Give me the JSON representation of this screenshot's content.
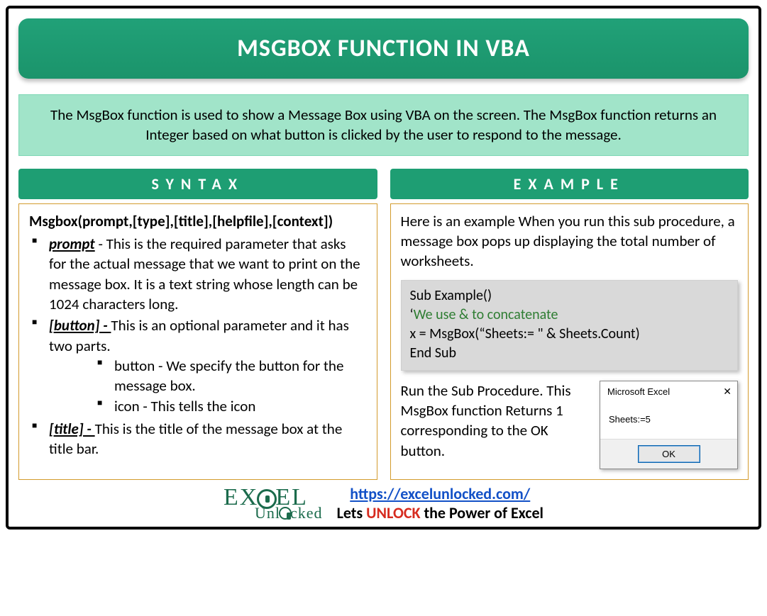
{
  "title": "MSGBOX FUNCTION IN VBA",
  "intro": "The MsgBox function is used to show a Message Box using VBA on the screen. The MsgBox function returns an Integer based on what button is clicked by the user to respond to the message.",
  "syntax": {
    "heading": "SYNTAX",
    "signature": "Msgbox(prompt,[type],[title],[helpfile],[context])",
    "params": {
      "prompt": {
        "name": "prompt",
        "desc": " - This is the required parameter that asks for the actual message that we want to print on the message box. It is a text string whose length can be 1024 characters long."
      },
      "button": {
        "name": "[button] - ",
        "desc": "This is an optional parameter and it has two parts.",
        "sub1": "button - We specify the button for the message box.",
        "sub2": "icon - This tells the icon"
      },
      "title": {
        "name": "[title] - ",
        "desc": "This is the title of the message box at the title bar."
      }
    }
  },
  "example": {
    "heading": "EXAMPLE",
    "lead": "Here is an example When you run this sub procedure, a message box pops up displaying the total number of worksheets.",
    "code": {
      "l1": "Sub Example()",
      "l2_prefix": "‘",
      "l2_comment": "We use & to concatenate",
      "l3": "x = MsgBox(“Sheets:= \" & Sheets.Count)",
      "l4": "End Sub"
    },
    "after": "Run the Sub Procedure. This MsgBox function Returns 1 corresponding to the OK button.",
    "dialog": {
      "title": "Microsoft Excel",
      "body": "Sheets:=5",
      "ok": "OK"
    }
  },
  "footer": {
    "logo_top": "EX   EL",
    "logo_bot": "Unl  cked",
    "url": "https://excelunlocked.com/",
    "tag_before": "Lets ",
    "tag_unlock": "UNLOCK",
    "tag_after": " the Power of Excel"
  }
}
